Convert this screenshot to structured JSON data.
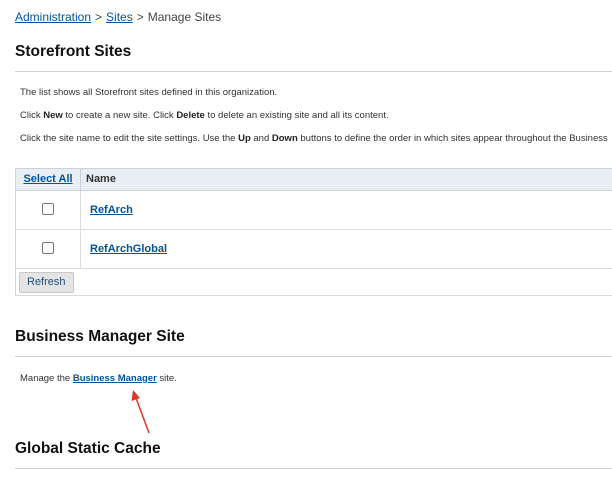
{
  "breadcrumb": {
    "items": [
      {
        "label": "Administration"
      },
      {
        "label": "Sites"
      },
      {
        "label": "Manage Sites"
      }
    ],
    "separator": ">"
  },
  "storefront": {
    "title": "Storefront Sites",
    "intro": "The list shows all Storefront sites defined in this organization.",
    "line2": {
      "p1": "Click ",
      "b1": "New",
      "p2": " to create a new site. Click ",
      "b2": "Delete",
      "p3": " to delete an existing site and all its content."
    },
    "line3": {
      "p1": "Click the site name to edit the site settings. Use the ",
      "b1": "Up",
      "p2": " and ",
      "b2": "Down",
      "p3": " buttons to define the order in which sites appear throughout the Business"
    },
    "table": {
      "select_all": "Select All",
      "name_header": "Name",
      "rows": [
        {
          "name": "RefArch"
        },
        {
          "name": "RefArchGlobal"
        }
      ],
      "refresh": "Refresh"
    }
  },
  "business_manager": {
    "title": "Business Manager Site",
    "text_before": "Manage the ",
    "link": "Business Manager",
    "text_after": " site."
  },
  "global_cache": {
    "title": "Global Static Cache"
  },
  "colors": {
    "link": "#00549f",
    "annotation_arrow": "#e0332a",
    "table_header_bg": "#e8eef4",
    "button_bg": "#e4e4e4"
  }
}
